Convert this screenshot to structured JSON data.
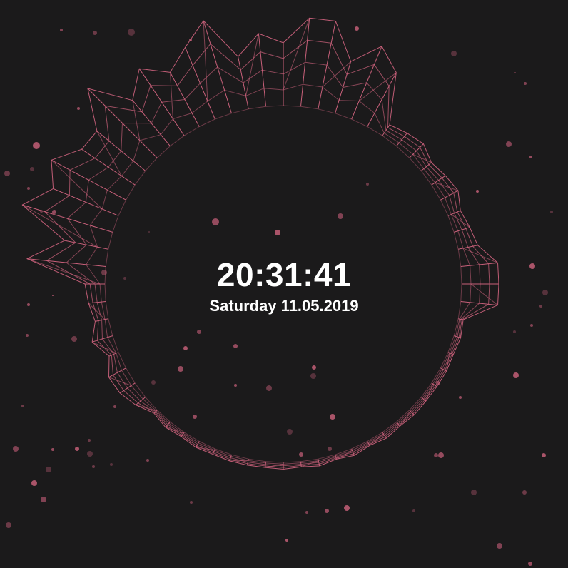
{
  "clock": {
    "time": "20:31:41",
    "date": "Saturday 11.05.2019"
  },
  "visualizer": {
    "name": "audio-wave-ring",
    "stroke_color": "#c8607a",
    "particle_color": "#c8607a",
    "background_color": "#1b1a1b"
  }
}
